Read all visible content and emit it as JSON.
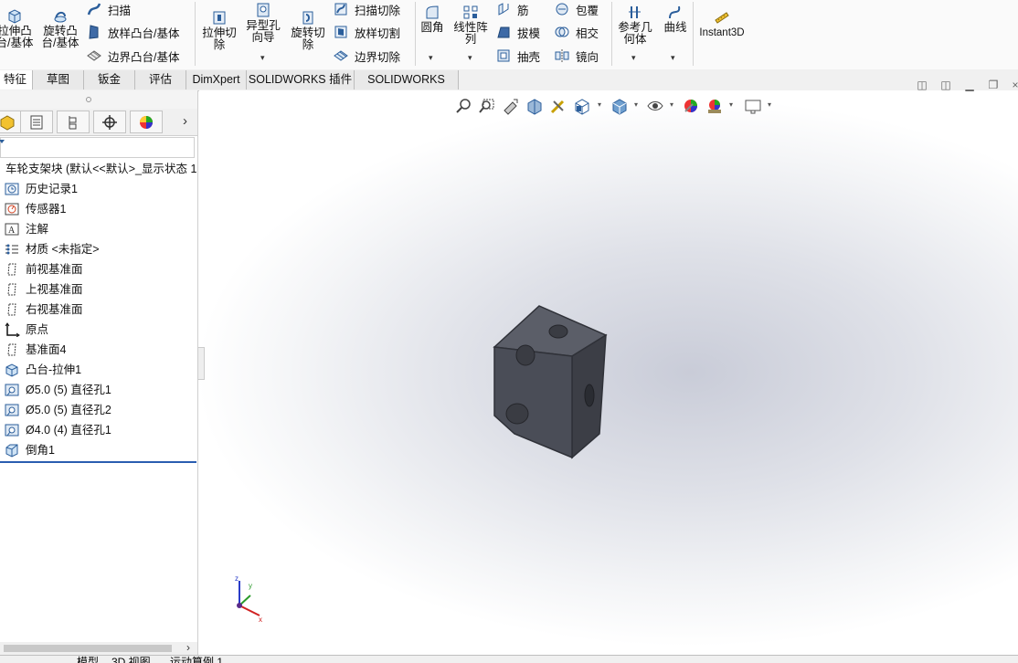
{
  "ribbon": {
    "extrude_boss": "拉伸凸\n台/基体",
    "revolve_boss": "旋转凸\n台/基体",
    "sweep": "扫描",
    "loft_boss": "放样凸台/基体",
    "boundary_boss": "边界凸台/基体",
    "extrude_cut": "拉伸切\n除",
    "hole_wizard": "异型孔\n向导",
    "revolve_cut": "旋转切\n除",
    "swept_cut": "扫描切除",
    "lofted_cut": "放样切割",
    "boundary_cut": "边界切除",
    "fillet": "圆角",
    "linear_pattern": "线性阵\n列",
    "rib": "筋",
    "draft": "拔模",
    "shell": "抽壳",
    "wrap": "包覆",
    "intersect": "相交",
    "mirror": "镜向",
    "ref_geometry": "参考几\n何体",
    "curves": "曲线",
    "instant3d": "Instant3D"
  },
  "tabs": [
    "特征",
    "草图",
    "钣金",
    "评估",
    "DimXpert",
    "SOLIDWORKS 插件",
    "SOLIDWORKS MBD"
  ],
  "tree": {
    "root": "车轮支架块 (默认<<默认>_显示状态 1",
    "items": [
      {
        "label": "历史记录1",
        "icon": "history-folder-icon"
      },
      {
        "label": "传感器1",
        "icon": "sensor-icon"
      },
      {
        "label": "注解",
        "icon": "annotation-icon"
      },
      {
        "label": "材质 <未指定>",
        "icon": "material-icon"
      },
      {
        "label": "前视基准面",
        "icon": "plane-icon"
      },
      {
        "label": "上视基准面",
        "icon": "plane-icon"
      },
      {
        "label": "右视基准面",
        "icon": "plane-icon"
      },
      {
        "label": "原点",
        "icon": "origin-icon"
      },
      {
        "label": "基准面4",
        "icon": "plane-icon"
      },
      {
        "label": "凸台-拉伸1",
        "icon": "extrude-feature-icon"
      },
      {
        "label": "Ø5.0 (5) 直径孔1",
        "icon": "hole-feature-icon"
      },
      {
        "label": "Ø5.0 (5) 直径孔2",
        "icon": "hole-feature-icon"
      },
      {
        "label": "Ø4.0 (4) 直径孔1",
        "icon": "hole-feature-icon"
      },
      {
        "label": "倒角1",
        "icon": "chamfer-feature-icon"
      }
    ]
  },
  "bottom_tabs": [
    "模型",
    "3D 视图",
    "运动算例 1"
  ],
  "triad": {
    "x": "x",
    "y": "y",
    "z": "z"
  },
  "colors": {
    "accent": "#2a5db0",
    "part": "#4a4d57"
  }
}
